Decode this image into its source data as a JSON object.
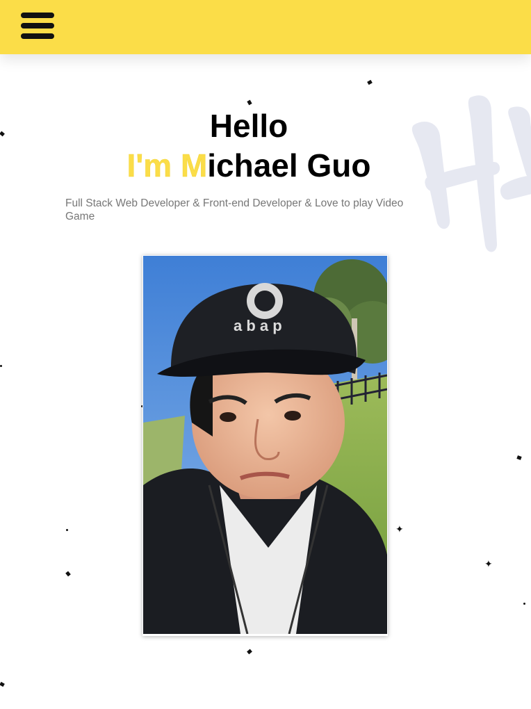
{
  "nav": {
    "menu_icon": "hamburger-menu-icon",
    "bar_color": "#fbdd48"
  },
  "hero": {
    "greeting": "Hello",
    "name_typed": "I'm M",
    "name_rest": "ichael Guo",
    "subtitle": "Full Stack Web Developer & Front-end Developer & Love to play Video Game"
  },
  "colors": {
    "accent": "#fbdd48",
    "text": "#000000",
    "subtext": "#777777",
    "brush": "#e4e6f0"
  },
  "profile": {
    "photo": "profile-photo-selfie"
  }
}
